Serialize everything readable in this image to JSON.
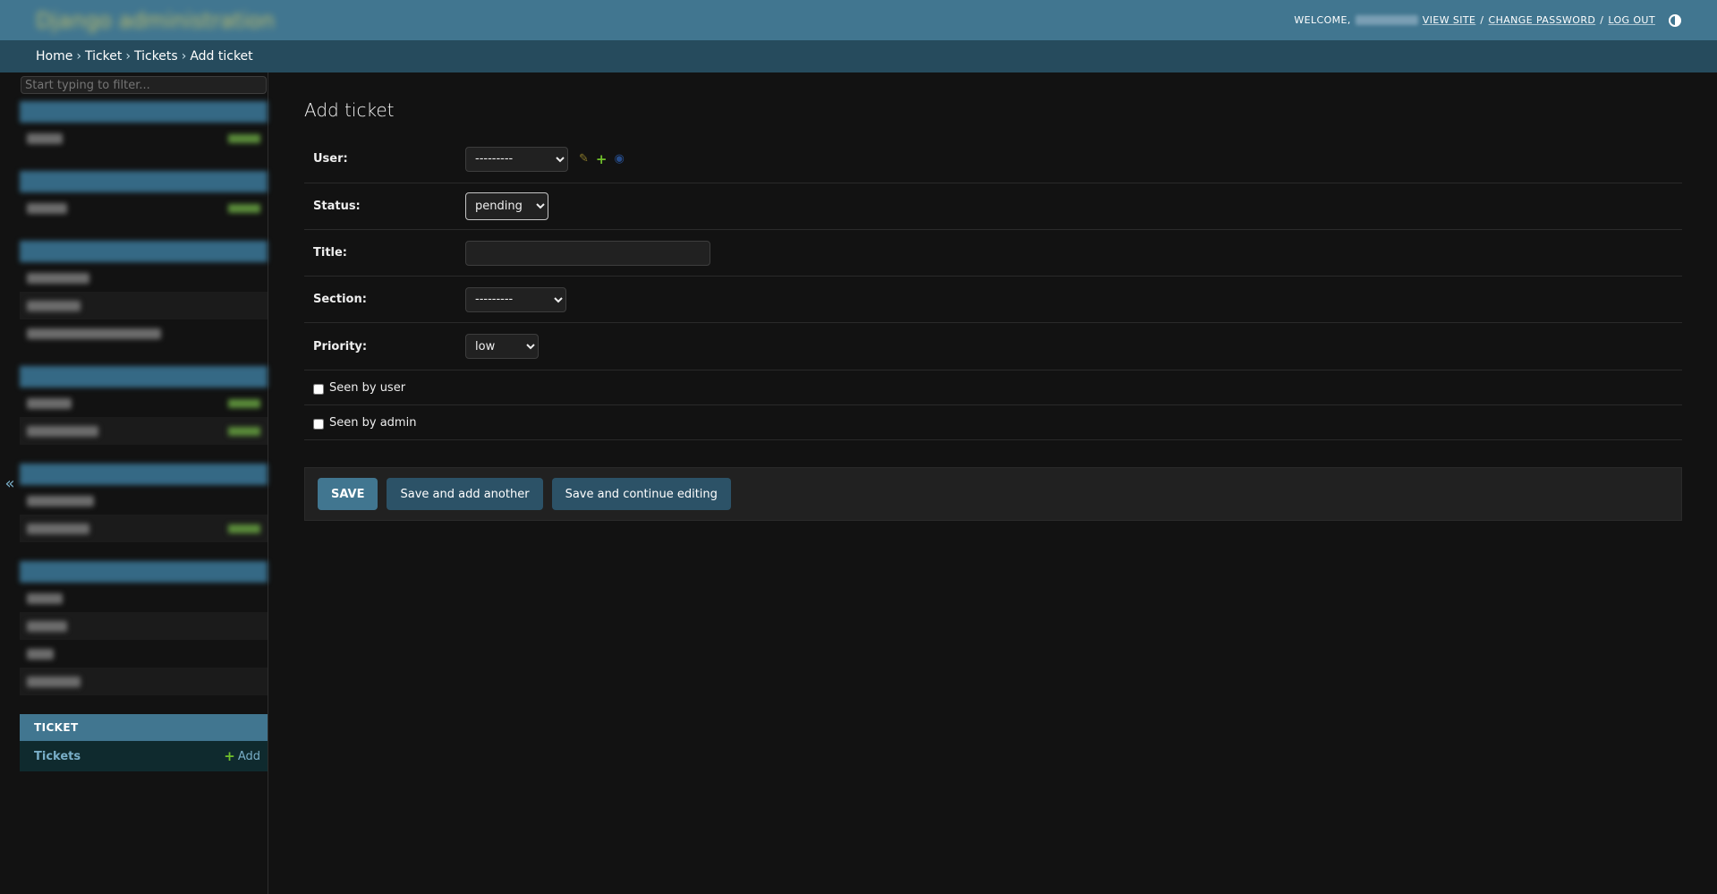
{
  "header": {
    "branding": "Django administration",
    "welcome_label": "WELCOME,",
    "view_site": "VIEW SITE",
    "change_password": "CHANGE PASSWORD",
    "log_out": "LOG OUT",
    "separator": "/"
  },
  "breadcrumbs": {
    "home": "Home",
    "app": "Ticket",
    "model": "Tickets",
    "current": "Add ticket",
    "separator": "›"
  },
  "sidebar": {
    "filter_placeholder": "Start typing to filter...",
    "toggle_glyph": "«",
    "ticket_app": {
      "caption": "TICKET",
      "model": "Tickets",
      "add": "Add"
    }
  },
  "form": {
    "title": "Add ticket",
    "fields": {
      "user": {
        "label": "User:",
        "value": "---------"
      },
      "status": {
        "label": "Status:",
        "value": "pending"
      },
      "title": {
        "label": "Title:",
        "value": ""
      },
      "section": {
        "label": "Section:",
        "value": "---------"
      },
      "priority": {
        "label": "Priority:",
        "value": "low"
      },
      "seen_by_user": {
        "label": "Seen by user",
        "checked": false
      },
      "seen_by_admin": {
        "label": "Seen by admin",
        "checked": false
      }
    },
    "buttons": {
      "save": "SAVE",
      "save_add_another": "Save and add another",
      "save_continue": "Save and continue editing"
    }
  },
  "colors": {
    "header_bg": "#417690",
    "breadcrumb_bg": "#264b5d",
    "page_bg": "#121212",
    "link": "#79aec8",
    "add_green": "#70bf2b"
  },
  "icons": [
    "theme-toggle-icon",
    "pencil-icon",
    "plus-icon",
    "eye-icon",
    "collapse-icon"
  ]
}
